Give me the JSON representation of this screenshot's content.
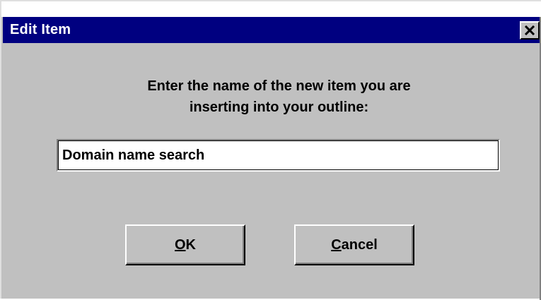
{
  "window": {
    "title": "Edit Item",
    "close_label": "×"
  },
  "prompt": {
    "line1": "Enter the name of the new item you are",
    "line2": "inserting into your outline:"
  },
  "name_field": {
    "value": "Domain name search"
  },
  "buttons": {
    "ok": {
      "mnemonic": "O",
      "rest": "K"
    },
    "cancel": {
      "mnemonic": "C",
      "rest": "ancel"
    }
  },
  "colors": {
    "title_bar": "#000080",
    "dialog_face": "#c0c0c0"
  }
}
